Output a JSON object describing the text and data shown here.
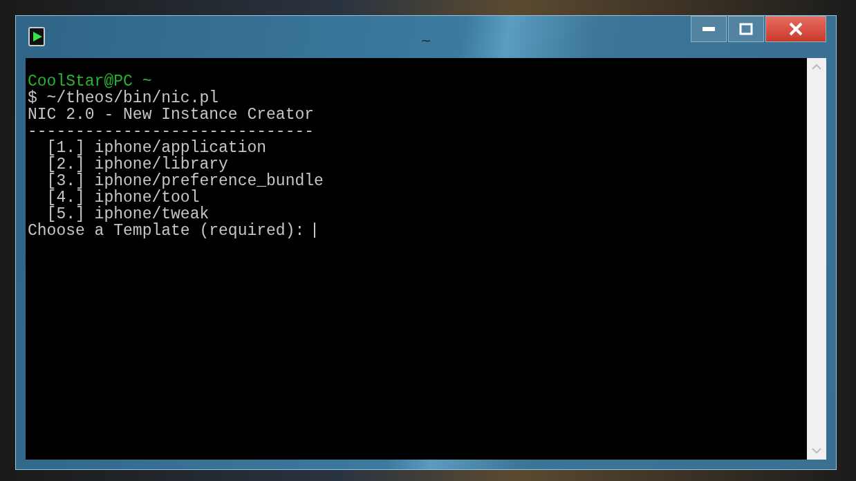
{
  "window": {
    "title": "~"
  },
  "terminal": {
    "lines": [
      {
        "kind": "prompt",
        "text": "CoolStar@PC ~"
      },
      {
        "kind": "output",
        "text": "$ ~/theos/bin/nic.pl"
      },
      {
        "kind": "output",
        "text": "NIC 2.0 - New Instance Creator"
      },
      {
        "kind": "output",
        "text": "------------------------------"
      },
      {
        "kind": "output",
        "text": "  [1.] iphone/application"
      },
      {
        "kind": "output",
        "text": "  [2.] iphone/library"
      },
      {
        "kind": "output",
        "text": "  [3.] iphone/preference_bundle"
      },
      {
        "kind": "output",
        "text": "  [4.] iphone/tool"
      },
      {
        "kind": "output",
        "text": "  [5.] iphone/tweak"
      },
      {
        "kind": "input",
        "text": "Choose a Template (required): ",
        "cursor": true
      }
    ]
  }
}
